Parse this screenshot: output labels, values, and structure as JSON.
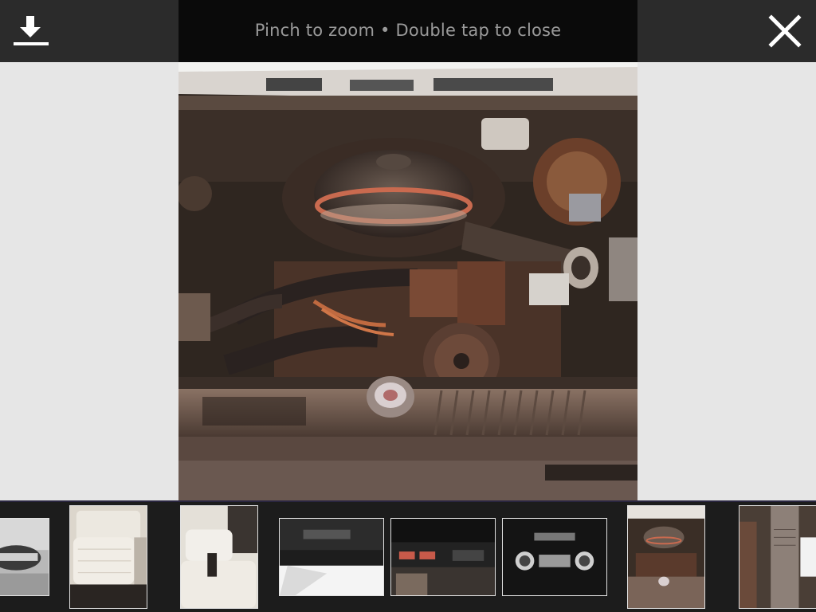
{
  "toolbar": {
    "hint_text": "Pinch to zoom • Double tap to close",
    "download_icon": "download-icon",
    "close_icon": "close-icon"
  },
  "photo": {
    "subject": "engine-bay-photo"
  },
  "filmstrip": {
    "thumbnails": [
      {
        "name": "thumbnail-car-front"
      },
      {
        "name": "thumbnail-rear-seat"
      },
      {
        "name": "thumbnail-front-seat"
      },
      {
        "name": "thumbnail-dashboard-trunk"
      },
      {
        "name": "thumbnail-dashboard-console"
      },
      {
        "name": "thumbnail-dashboard-radio"
      },
      {
        "name": "thumbnail-engine-bay",
        "selected": true
      },
      {
        "name": "thumbnail-door-jamb-tag"
      }
    ]
  },
  "colors": {
    "toolbar_bg": "#2b2b2b",
    "toolbar_center_bg": "#0a0a0a",
    "hint_text": "#9a9a9a",
    "page_bg": "#e6e6e6",
    "filmstrip_bg": "#1c1c1c"
  }
}
